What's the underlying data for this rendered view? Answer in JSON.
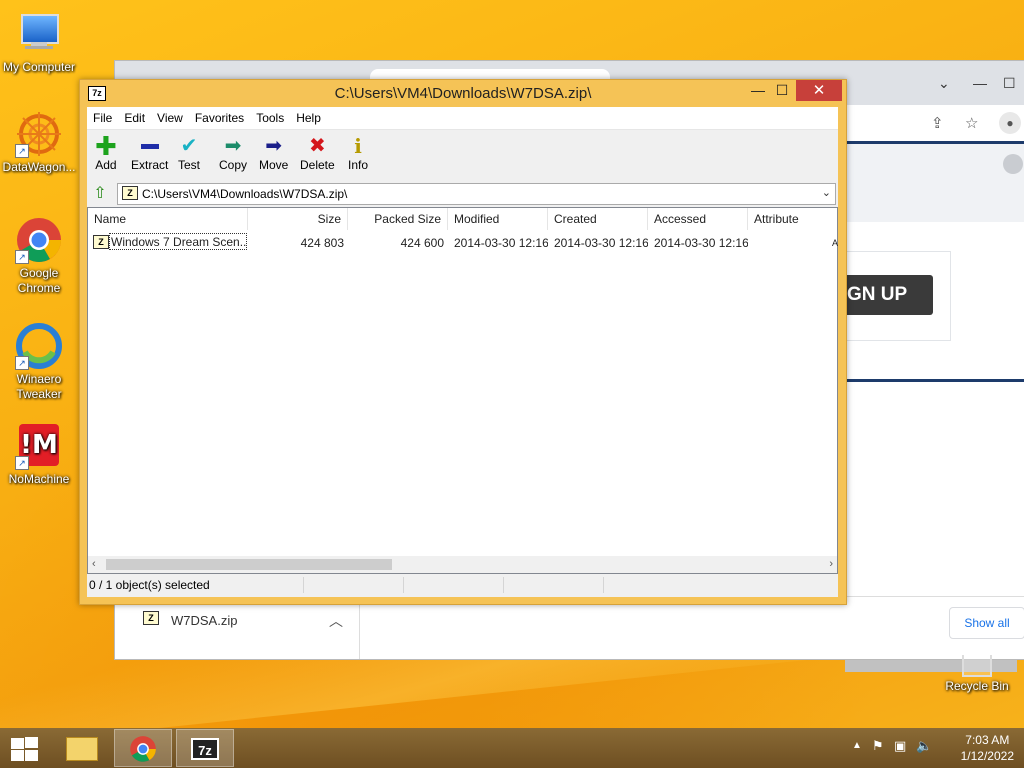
{
  "desktop": {
    "icons": [
      {
        "label": "My Computer"
      },
      {
        "label": "DataWagon..."
      },
      {
        "label": "Google Chrome"
      },
      {
        "label": "Winaero Tweaker"
      },
      {
        "label": "NoMachine"
      }
    ],
    "recycle_bin": "Recycle Bin"
  },
  "chrome": {
    "signup": "GN UP",
    "download_file": "W7DSA.zip",
    "show_all": "Show all"
  },
  "zip": {
    "title": "C:\\Users\\VM4\\Downloads\\W7DSA.zip\\",
    "app_icon": "7z",
    "menu": [
      "File",
      "Edit",
      "View",
      "Favorites",
      "Tools",
      "Help"
    ],
    "toolbar": [
      "Add",
      "Extract",
      "Test",
      "Copy",
      "Move",
      "Delete",
      "Info"
    ],
    "address": "C:\\Users\\VM4\\Downloads\\W7DSA.zip\\",
    "columns": [
      "Name",
      "Size",
      "Packed Size",
      "Modified",
      "Created",
      "Accessed",
      "Attribute"
    ],
    "rows": [
      {
        "name": "Windows 7 Dream Scen...",
        "size": "424 803",
        "packed": "424 600",
        "modified": "2014-03-30 12:16",
        "created": "2014-03-30 12:16",
        "accessed": "2014-03-30 12:16",
        "attr": "A"
      }
    ],
    "status": "0 / 1 object(s) selected"
  },
  "taskbar": {
    "seven_zip_label": "7z",
    "time": "7:03 AM",
    "date": "1/12/2022"
  }
}
